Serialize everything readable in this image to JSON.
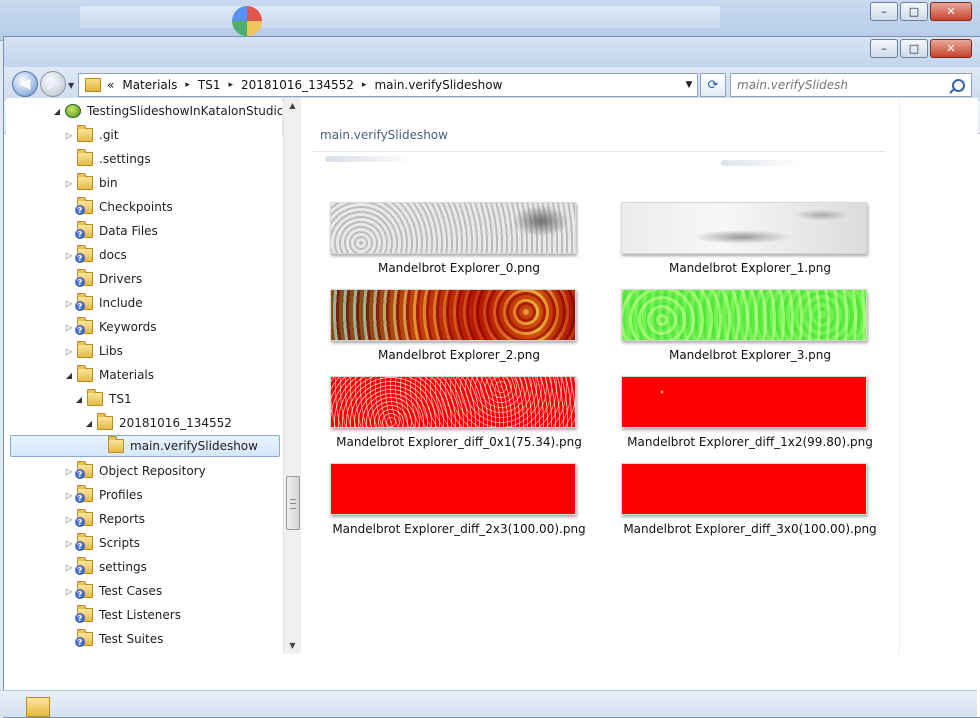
{
  "background_window": {
    "buttons": {
      "minimize": "–",
      "maximize": "□",
      "close": "✕"
    }
  },
  "window": {
    "buttons": {
      "minimize": "–",
      "maximize": "□",
      "close": "✕"
    }
  },
  "nav": {
    "back_icon": "back-arrow-icon",
    "forward_icon": "forward-arrow-icon",
    "breadcrumb_prefix": "«",
    "breadcrumbs": [
      "Materials",
      "TS1",
      "20181016_134552",
      "main.verifySlideshow"
    ],
    "breadcrumb_separator": "▸",
    "refresh_icon": "refresh-icon",
    "search_placeholder": "main.verifySlidesh"
  },
  "toolbar": {
    "view_icon": "view-options-icon",
    "pane_icon": "preview-pane-icon",
    "help_label": "?"
  },
  "tree": {
    "items": [
      {
        "label": "TestingSlideshowInKatalonStudio",
        "expanded": true,
        "type": "project"
      },
      {
        "label": ".git",
        "expanded": false,
        "type": "folder"
      },
      {
        "label": ".settings",
        "expanded": null,
        "type": "folder"
      },
      {
        "label": "bin",
        "expanded": false,
        "type": "folder"
      },
      {
        "label": "Checkpoints",
        "expanded": null,
        "type": "folder-badge"
      },
      {
        "label": "Data Files",
        "expanded": null,
        "type": "folder-badge"
      },
      {
        "label": "docs",
        "expanded": false,
        "type": "folder-badge"
      },
      {
        "label": "Drivers",
        "expanded": null,
        "type": "folder-badge"
      },
      {
        "label": "Include",
        "expanded": false,
        "type": "folder-badge"
      },
      {
        "label": "Keywords",
        "expanded": false,
        "type": "folder-badge"
      },
      {
        "label": "Libs",
        "expanded": false,
        "type": "folder"
      },
      {
        "label": "Materials",
        "expanded": true,
        "type": "folder"
      },
      {
        "label": "TS1",
        "expanded": true,
        "type": "folder"
      },
      {
        "label": "20181016_134552",
        "expanded": true,
        "type": "folder"
      },
      {
        "label": "main.verifySlideshow",
        "expanded": null,
        "type": "folder",
        "selected": true
      },
      {
        "label": "Object Repository",
        "expanded": false,
        "type": "folder-badge"
      },
      {
        "label": "Profiles",
        "expanded": false,
        "type": "folder-badge"
      },
      {
        "label": "Reports",
        "expanded": false,
        "type": "folder-badge"
      },
      {
        "label": "Scripts",
        "expanded": false,
        "type": "folder-badge"
      },
      {
        "label": "settings",
        "expanded": false,
        "type": "folder-badge"
      },
      {
        "label": "Test Cases",
        "expanded": false,
        "type": "folder-badge"
      },
      {
        "label": "Test Listeners",
        "expanded": null,
        "type": "folder-badge"
      },
      {
        "label": "Test Suites",
        "expanded": null,
        "type": "folder-badge"
      }
    ],
    "scroll": {
      "up": "▲",
      "down": "▼"
    }
  },
  "content": {
    "library_title": "main.verifySlideshow",
    "files": [
      {
        "name": "Mandelbrot Explorer_0.png",
        "thumb": "t0"
      },
      {
        "name": "Mandelbrot Explorer_1.png",
        "thumb": "t1"
      },
      {
        "name": "Mandelbrot Explorer_2.png",
        "thumb": "t2"
      },
      {
        "name": "Mandelbrot Explorer_3.png",
        "thumb": "t3"
      },
      {
        "name": "Mandelbrot Explorer_diff_0x1(75.34).png",
        "thumb": "t4"
      },
      {
        "name": "Mandelbrot Explorer_diff_1x2(99.80).png",
        "thumb": "t5"
      },
      {
        "name": "Mandelbrot Explorer_diff_2x3(100.00).png",
        "thumb": "tred"
      },
      {
        "name": "Mandelbrot Explorer_diff_3x0(100.00).png",
        "thumb": "tred"
      }
    ]
  },
  "colors": {
    "selection_border": "#84acdd",
    "diff_red": "#ff0000",
    "chrome_blue": "#c2d4ec"
  }
}
